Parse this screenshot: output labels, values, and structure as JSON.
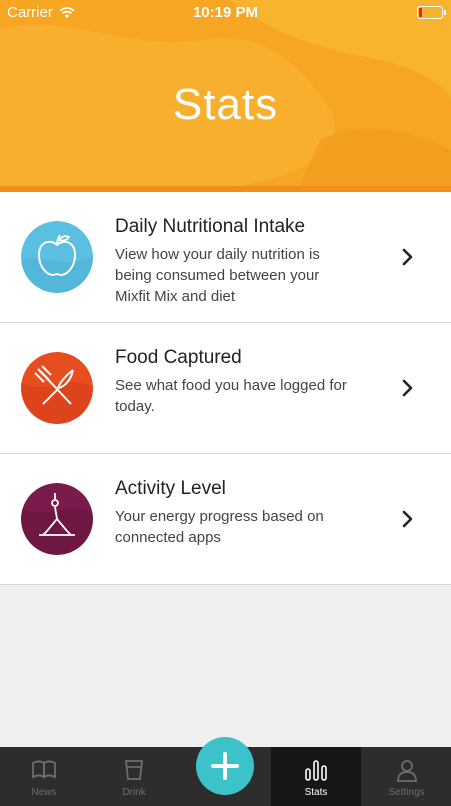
{
  "status_bar": {
    "carrier": "Carrier",
    "time": "10:19 PM"
  },
  "header": {
    "title": "Stats"
  },
  "items": [
    {
      "title": "Daily Nutritional Intake",
      "description": "View how your daily nutrition is being consumed between your Mixfit Mix and diet",
      "icon": "apple-icon",
      "color": "#5bbfe2"
    },
    {
      "title": "Food Captured",
      "description": "See what food you have logged for today.",
      "icon": "fork-knife-icon",
      "color": "#e64d1f"
    },
    {
      "title": "Activity Level",
      "description": "Your energy progress based on connected apps",
      "icon": "yoga-pose-icon",
      "color": "#7a1b4b"
    }
  ],
  "tabbar": {
    "tabs": [
      {
        "label": "News",
        "icon": "book-icon"
      },
      {
        "label": "Drink",
        "icon": "cup-icon"
      },
      {
        "label": "Stats",
        "icon": "bar-chart-icon",
        "active": true
      },
      {
        "label": "Settings",
        "icon": "person-icon"
      }
    ],
    "fab_icon": "plus-icon"
  },
  "colors": {
    "header": "#f6a623",
    "fab": "#3cc3ca",
    "tabbar": "#2d2d2d"
  }
}
